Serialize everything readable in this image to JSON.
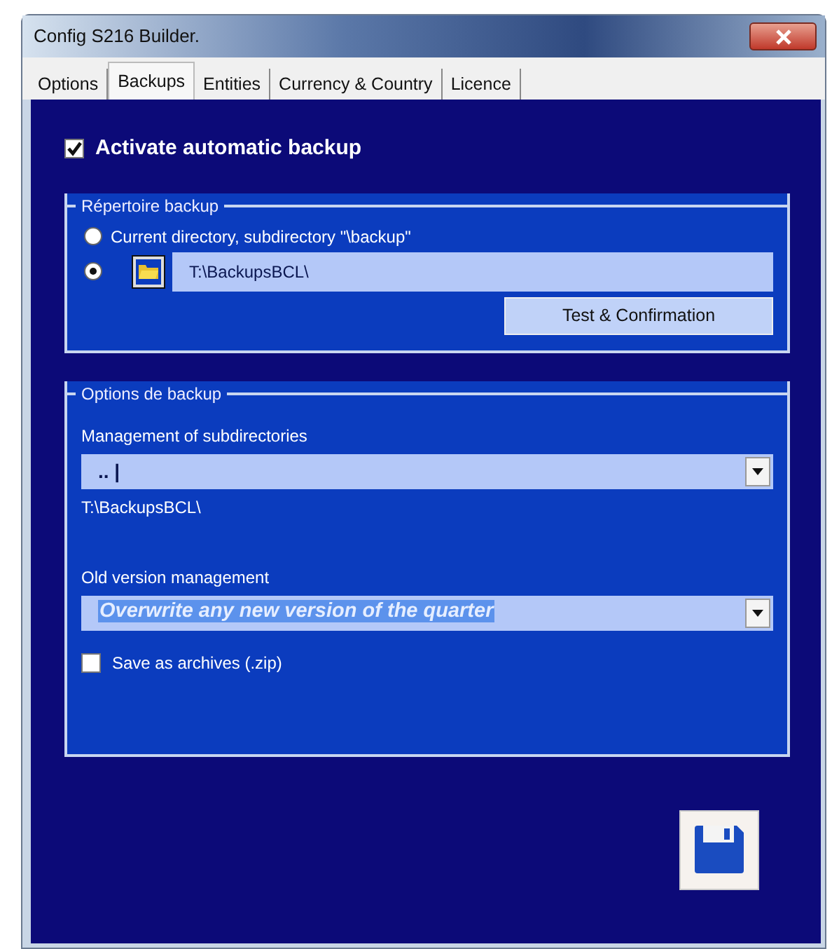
{
  "window": {
    "title": "Config S216 Builder."
  },
  "tabs": [
    {
      "label": "Options",
      "selected": false
    },
    {
      "label": "Backups",
      "selected": true
    },
    {
      "label": "Entities",
      "selected": false
    },
    {
      "label": "Currency & Country",
      "selected": false
    },
    {
      "label": "Licence",
      "selected": false
    }
  ],
  "auto_backup": {
    "label": "Activate automatic backup",
    "checked": true
  },
  "directory_group": {
    "title": "Répertoire backup",
    "options": [
      {
        "kind": "text",
        "label": "Current directory, subdirectory \"\\backup\"",
        "selected": false
      },
      {
        "kind": "path",
        "value": "T:\\BackupsBCL\\",
        "selected": true
      }
    ],
    "button": "Test & Confirmation"
  },
  "options_group": {
    "title": "Options de backup",
    "subdirectories": {
      "label": "Management of subdirectories",
      "value": ".. |",
      "path": "T:\\BackupsBCL\\"
    },
    "old_version": {
      "label": "Old version management",
      "value": "Overwrite any new version of the quarter",
      "highlighted": true
    },
    "archive": {
      "label": "Save as archives (.zip)",
      "checked": false
    }
  }
}
